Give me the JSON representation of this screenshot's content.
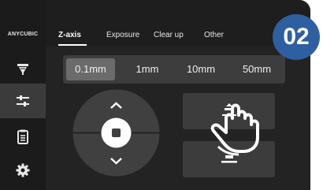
{
  "brand": {
    "logo_text": "ANYCUBIC"
  },
  "tabs": [
    {
      "label": "Z-axis",
      "active": true
    },
    {
      "label": "Exposure"
    },
    {
      "label": "Clear up"
    },
    {
      "label": "Other"
    }
  ],
  "sidebar": {
    "items": [
      {
        "icon": "print-nozzle-icon"
      },
      {
        "icon": "sliders-icon",
        "active": true
      },
      {
        "icon": "document-icon"
      },
      {
        "icon": "gear-icon"
      }
    ]
  },
  "step_selector": {
    "options": [
      "0.1mm",
      "1mm",
      "10mm",
      "50mm"
    ],
    "selected": "0.1mm"
  },
  "dpad": {
    "up": "chevron-up-icon",
    "center": "stop-icon",
    "down": "chevron-down-icon"
  },
  "actions": [
    {
      "icon": "z-home-icon"
    },
    {
      "icon": "z-zero-icon"
    }
  ],
  "badge": {
    "text": "02"
  },
  "colors": {
    "screen": "#232323",
    "badge": "#2e5fa0",
    "active_step": "#6b6b6b"
  }
}
